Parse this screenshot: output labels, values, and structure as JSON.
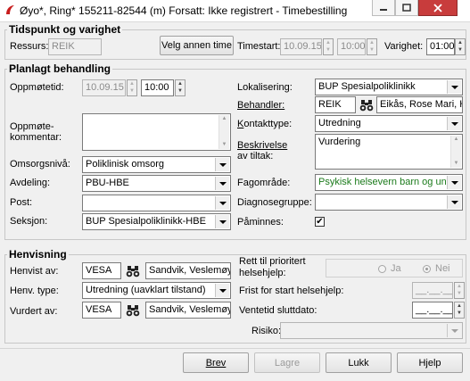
{
  "window": {
    "title": "Øyo*, Ring*  155211-82544 (m)  Forsatt: Ikke registrert - Timebestilling"
  },
  "tidspunkt": {
    "group_title": "Tidspunkt og varighet",
    "ressurs_label": "Ressurs:",
    "ressurs_value": "REIK",
    "velg_button": "Velg annen time",
    "timestart_label": "Timestart:",
    "timestart_date": "10.09.15",
    "timestart_time": "10:00",
    "varighet_label": "Varighet:",
    "varighet_value": "01:00"
  },
  "planlagt": {
    "group_title": "Planlagt behandling",
    "oppmotetid_label": "Oppmøtetid:",
    "oppmote_date": "10.09.15",
    "oppmote_time": "10:00",
    "kommentar_label_1": "Oppmøte-",
    "kommentar_label_2": "kommentar:",
    "kommentar_value": "",
    "omsorgsniva_label": "Omsorgsnivå:",
    "omsorgsniva_value": "Poliklinisk omsorg",
    "avdeling_label": "Avdeling:",
    "avdeling_value": "PBU-HBE",
    "post_label": "Post:",
    "post_value": "",
    "seksjon_label": "Seksjon:",
    "seksjon_value": "BUP Spesialpoliklinikk-HBE",
    "lokalisering_label": "Lokalisering:",
    "lokalisering_value": "BUP Spesialpoliklinikk",
    "behandler_label": "Behandler:",
    "behandler_code": "REIK",
    "behandler_name": "Eikås, Rose Mari, H",
    "kontakttype_label": "Kontakttype:",
    "kontakttype_value": "Utredning",
    "beskrivelse_label_1": "Beskrivelse",
    "beskrivelse_label_2": "av tiltak:",
    "beskrivelse_value": "Vurdering",
    "fagomrade_label": "Fagområde:",
    "fagomrade_value": "Psykisk helsevern barn og ung",
    "diagnosegruppe_label": "Diagnosegruppe:",
    "diagnosegruppe_value": "",
    "paminnes_label": "Påminnes:",
    "paminnes_checked": "✔"
  },
  "henvisning": {
    "group_title": "Henvisning",
    "henvist_av_label": "Henvist av:",
    "henvist_av_code": "VESA",
    "henvist_av_name": "Sandvik, Veslemøy,",
    "henv_type_label": "Henv. type:",
    "henv_type_value": "Utredning (uavklart tilstand)",
    "vurdert_av_label": "Vurdert av:",
    "vurdert_av_code": "VESA",
    "vurdert_av_name": "Sandvik, Veslemøy,",
    "rett_label_1": "Rett til prioritert",
    "rett_label_2": "helsehjelp:",
    "ja_label": "Ja",
    "nei_label": "Nei",
    "frist_label": "Frist for start helsehjelp:",
    "frist_value": "__.__.__",
    "ventetid_label": "Ventetid sluttdato:",
    "ventetid_value": "__.__.__",
    "risiko_label": "Risiko:",
    "risiko_value": ""
  },
  "footer": {
    "brev": "Brev",
    "lagre": "Lagre",
    "lukk": "Lukk",
    "hjelp": "Hjelp"
  },
  "colors": {
    "fagomrade_text": "#1a7a1a",
    "close_button": "#c83c3c"
  }
}
